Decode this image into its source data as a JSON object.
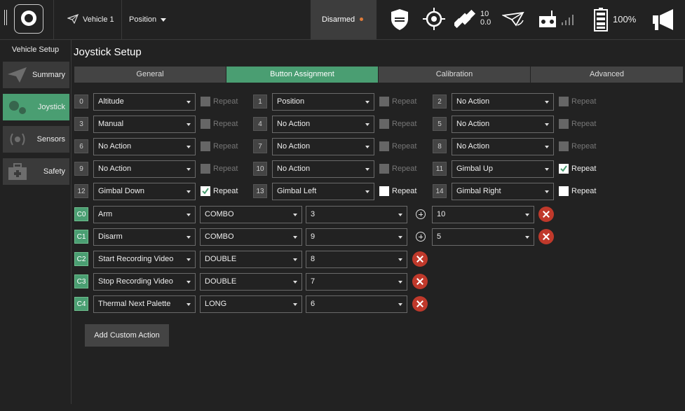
{
  "topbar": {
    "vehicle": "Vehicle 1",
    "mode": "Position",
    "armed_status": "Disarmed",
    "armed_dot_color": "#e07b39",
    "gps_count": "10",
    "gps_hdop": "0.0",
    "battery": "100%"
  },
  "sidebar": {
    "title": "Vehicle Setup",
    "items": [
      {
        "label": "Summary"
      },
      {
        "label": "Joystick"
      },
      {
        "label": "Sensors"
      },
      {
        "label": "Safety"
      }
    ]
  },
  "page_title": "Joystick Setup",
  "tabs": [
    "General",
    "Button Assignment",
    "Calibration",
    "Advanced"
  ],
  "active_tab": "Button Assignment",
  "repeat_label": "Repeat",
  "buttons": [
    {
      "num": "0",
      "action": "Altitude",
      "repeat": false
    },
    {
      "num": "1",
      "action": "Position",
      "repeat": false
    },
    {
      "num": "2",
      "action": "No Action",
      "repeat": false
    },
    {
      "num": "3",
      "action": "Manual",
      "repeat": false
    },
    {
      "num": "4",
      "action": "No Action",
      "repeat": false
    },
    {
      "num": "5",
      "action": "No Action",
      "repeat": false
    },
    {
      "num": "6",
      "action": "No Action",
      "repeat": false
    },
    {
      "num": "7",
      "action": "No Action",
      "repeat": false
    },
    {
      "num": "8",
      "action": "No Action",
      "repeat": false
    },
    {
      "num": "9",
      "action": "No Action",
      "repeat": false
    },
    {
      "num": "10",
      "action": "No Action",
      "repeat": false
    },
    {
      "num": "11",
      "action": "Gimbal Up",
      "repeat": true
    },
    {
      "num": "12",
      "action": "Gimbal Down",
      "repeat": true
    },
    {
      "num": "13",
      "action": "Gimbal Left",
      "repeat": false
    },
    {
      "num": "14",
      "action": "Gimbal Right",
      "repeat": false
    }
  ],
  "custom": [
    {
      "id": "C0",
      "action": "Arm",
      "type": "COMBO",
      "button": "3",
      "button2": "10"
    },
    {
      "id": "C1",
      "action": "Disarm",
      "type": "COMBO",
      "button": "9",
      "button2": "5"
    },
    {
      "id": "C2",
      "action": "Start Recording Video",
      "type": "DOUBLE",
      "button": "8"
    },
    {
      "id": "C3",
      "action": "Stop Recording Video",
      "type": "DOUBLE",
      "button": "7"
    },
    {
      "id": "C4",
      "action": "Thermal Next Palette",
      "type": "LONG",
      "button": "6"
    }
  ],
  "add_button": "Add Custom Action",
  "colors": {
    "accent": "#4a9e72",
    "delete": "#c0392b"
  }
}
